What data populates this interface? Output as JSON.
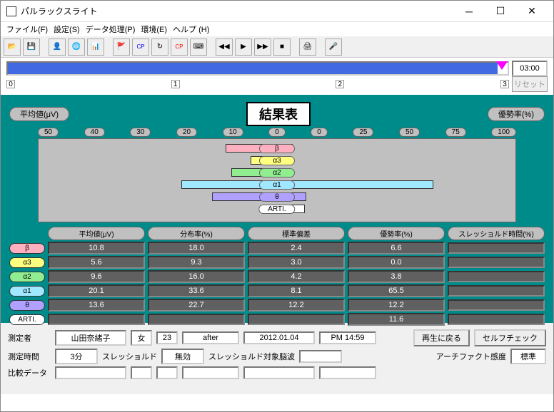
{
  "window": {
    "title": "パルラックスライト"
  },
  "menu": {
    "file": "ファイル(F)",
    "settings": "設定(S)",
    "data": "データ処理(P)",
    "env": "環境(E)",
    "help": "ヘルプ (H)"
  },
  "progress": {
    "time": "03:00",
    "reset": "リセット",
    "ticks": [
      "0",
      "1",
      "2",
      "3"
    ]
  },
  "result": {
    "title": "結果表",
    "avg_label": "平均値(μV)",
    "dom_label": "優勢率(%)",
    "axis_left": [
      "50",
      "40",
      "30",
      "20",
      "10",
      "0"
    ],
    "axis_right": [
      "0",
      "25",
      "50",
      "75",
      "100"
    ],
    "bands": [
      "β",
      "α3",
      "α2",
      "α1",
      "θ",
      "ARTI."
    ]
  },
  "table": {
    "headers": [
      "平均値(μV)",
      "分布率(%)",
      "標準偏差",
      "優勢率(%)",
      "スレッショルド時間(%)"
    ],
    "rows": [
      {
        "label": "β",
        "v": [
          "10.8",
          "18.0",
          "2.4",
          "6.6",
          ""
        ]
      },
      {
        "label": "α3",
        "v": [
          "5.6",
          "9.3",
          "3.0",
          "0.0",
          ""
        ]
      },
      {
        "label": "α2",
        "v": [
          "9.6",
          "16.0",
          "4.2",
          "3.8",
          ""
        ]
      },
      {
        "label": "α1",
        "v": [
          "20.1",
          "33.6",
          "8.1",
          "65.5",
          ""
        ]
      },
      {
        "label": "θ",
        "v": [
          "13.6",
          "22.7",
          "12.2",
          "12.2",
          ""
        ]
      },
      {
        "label": "ARTI.",
        "v": [
          "",
          "",
          "",
          "11.6",
          ""
        ]
      }
    ]
  },
  "info": {
    "measurer_label": "測定者",
    "name": "山田奈緒子",
    "gender": "女",
    "age": "23",
    "phase": "after",
    "date": "2012.01.04",
    "time": "PM 14:59",
    "playback_btn": "再生に戻る",
    "selfcheck_btn": "セルフチェック",
    "meas_time_label": "測定時間",
    "meas_time": "3分",
    "threshold_label": "スレッショルド",
    "threshold": "無効",
    "threshold_target_label": "スレッショルド対象脳波",
    "artifact_label": "アーチファクト感度",
    "artifact": "標準",
    "compare_label": "比較データ"
  },
  "chart_data": {
    "type": "bar",
    "title": "結果表",
    "left": {
      "label": "平均値(μV)",
      "range": [
        0,
        50
      ]
    },
    "right": {
      "label": "優勢率(%)",
      "range": [
        0,
        100
      ]
    },
    "series": [
      {
        "name": "β",
        "avg": 10.8,
        "dom": 6.6,
        "color": "#ffb0c0"
      },
      {
        "name": "α3",
        "avg": 5.6,
        "dom": 0.0,
        "color": "#ffff80"
      },
      {
        "name": "α2",
        "avg": 9.6,
        "dom": 3.8,
        "color": "#90ee90"
      },
      {
        "name": "α1",
        "avg": 20.1,
        "dom": 65.5,
        "color": "#a0e8ff"
      },
      {
        "name": "θ",
        "avg": 13.6,
        "dom": 12.2,
        "color": "#b0a0ff"
      },
      {
        "name": "ARTI.",
        "avg": null,
        "dom": 11.6,
        "color": "#ffffff"
      }
    ]
  }
}
